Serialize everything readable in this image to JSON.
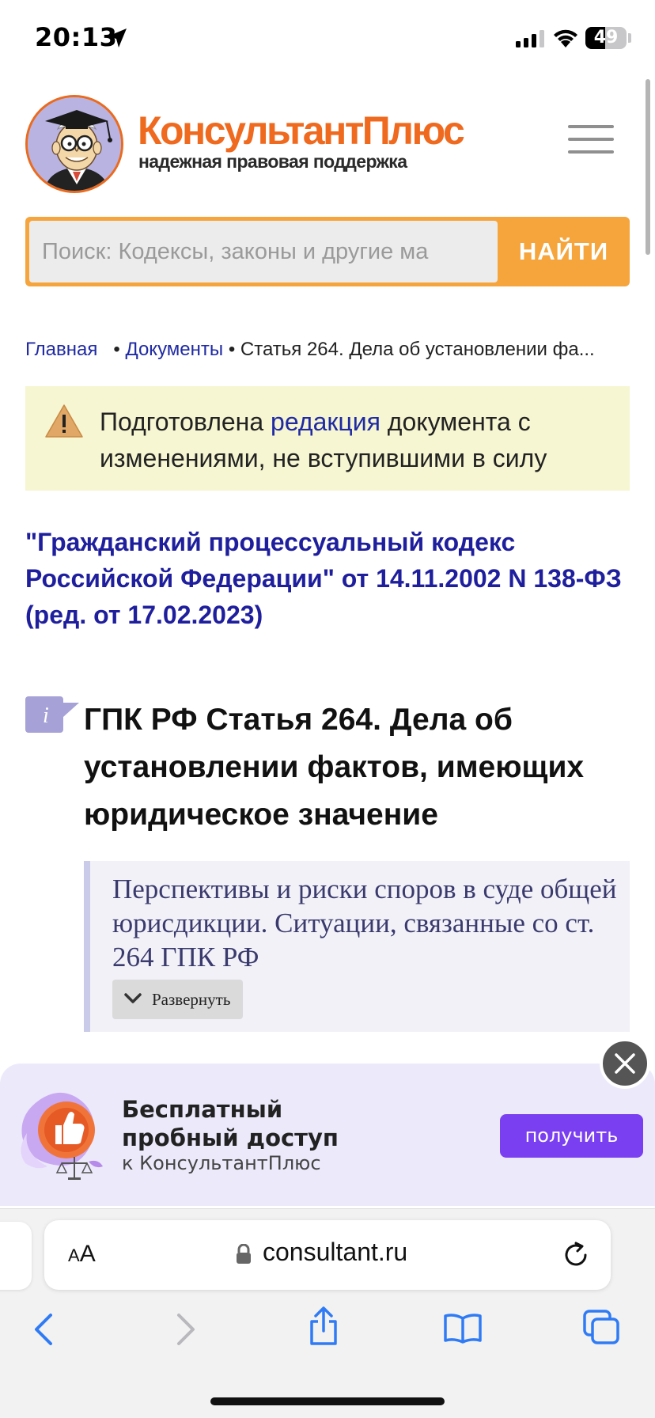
{
  "status_bar": {
    "time": "20:13",
    "battery": "49",
    "battery_level": 0.49
  },
  "header": {
    "brand_name": "КонсультантПлюс",
    "tagline": "надежная правовая поддержка"
  },
  "search": {
    "placeholder": "Поиск: Кодексы, законы и другие ма",
    "button_label": "НАЙТИ"
  },
  "breadcrumb": {
    "home": "Главная",
    "documents": "Документы",
    "current": "Статья 264. Дела об установлении фа..."
  },
  "notice": {
    "before_link": "Подготовлена ",
    "link": "редакция",
    "after_link": " документа с изменениями, не вступившими в силу"
  },
  "document": {
    "title": "\"Гражданский процессуальный кодекс Российской Федерации\" от 14.11.2002 N 138-ФЗ (ред. от 17.02.2023)"
  },
  "article": {
    "info_icon_label": "i",
    "title": "ГПК РФ Статья 264. Дела об установлении фактов, имеющих юридическое значение"
  },
  "perspective": {
    "text": "Перспективы и риски споров в суде общей юрисдикции. Ситуации, связанные со ст. 264 ГПК РФ",
    "expand_label": "Развернуть"
  },
  "promo": {
    "title": "Бесплатный пробный доступ",
    "subtitle": "к КонсультантПлюс",
    "button_label": "получить"
  },
  "browser": {
    "aa_large": "A",
    "aa_small": "A",
    "url": "consultant.ru"
  },
  "colors": {
    "brand_orange": "#ef6a1f",
    "search_orange": "#f5a53c",
    "link_blue": "#1f2aa3",
    "promo_purple": "#7a3ff0"
  },
  "icons": [
    "location-arrow-icon",
    "signal-icon",
    "wifi-icon",
    "battery-icon",
    "menu-icon",
    "warning-icon",
    "info-icon",
    "chevron-down-icon",
    "close-icon",
    "thumbs-up-icon",
    "lock-icon",
    "reload-icon",
    "back-icon",
    "forward-icon",
    "share-icon",
    "bookmarks-icon",
    "tabs-icon"
  ]
}
